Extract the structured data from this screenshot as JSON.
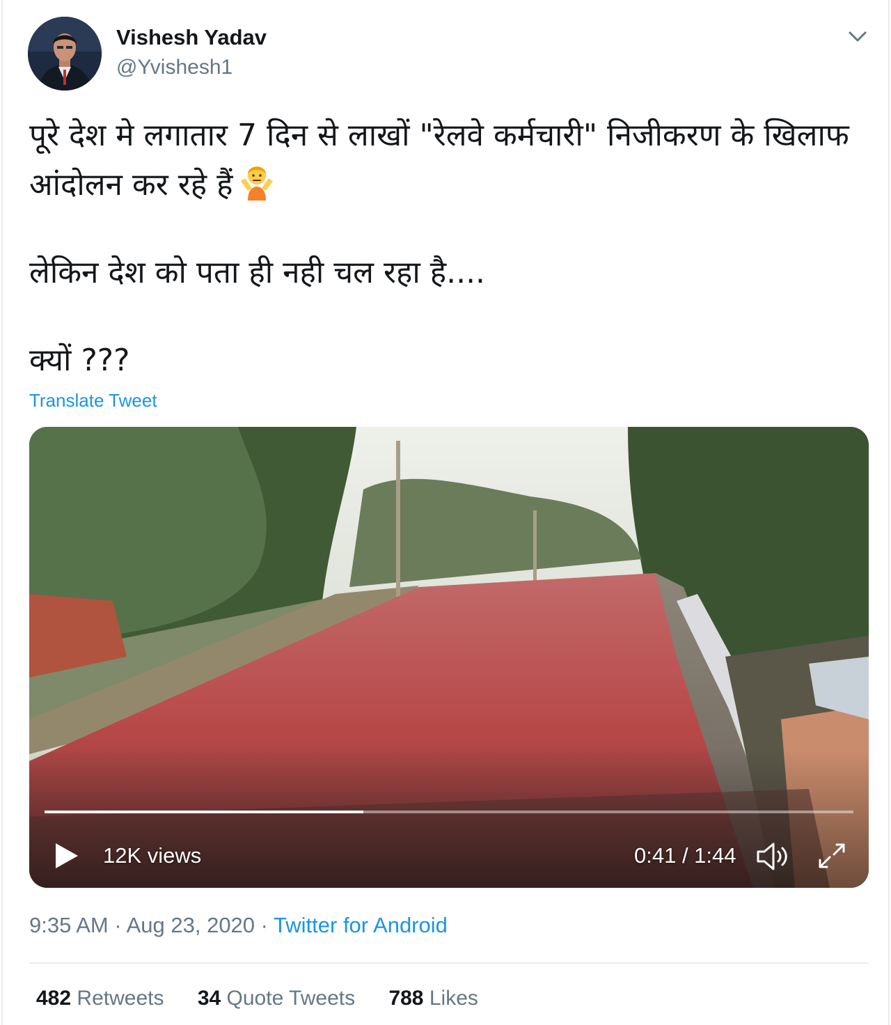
{
  "user": {
    "display_name": "Vishesh Yadav",
    "handle": "@Yvishesh1",
    "avatar_icon": "user-photo"
  },
  "menu_icon": "chevron-down-icon",
  "tweet": {
    "line1": "पूरे देश मे लगातार 7 दिन से लाखों \"रेलवे कर्मचारी\" निजीकरण के खिलाफ आंदोलन कर रहे हैं",
    "emoji": "person-shrugging-emoji",
    "line2": "लेकिन देश को पता ही नही चल रहा है....",
    "line3": "क्यों ???"
  },
  "translate_label": "Translate Tweet",
  "video": {
    "views": "12K views",
    "time": "0:41 / 1:44",
    "progress_fraction": 0.394,
    "play_icon": "play-icon",
    "volume_icon": "volume-icon",
    "fullscreen_icon": "fullscreen-icon"
  },
  "meta": {
    "time": "9:35 AM",
    "separator": " · ",
    "date": "Aug 23, 2020",
    "source": "Twitter for Android"
  },
  "stats": {
    "retweets_count": "482",
    "retweets_label": "Retweets",
    "quotes_count": "34",
    "quotes_label": "Quote Tweets",
    "likes_count": "788",
    "likes_label": "Likes"
  },
  "colors": {
    "link": "#1b95e0",
    "secondary_text": "#657786",
    "primary_text": "#14171a",
    "divider": "#e6ecf0"
  }
}
